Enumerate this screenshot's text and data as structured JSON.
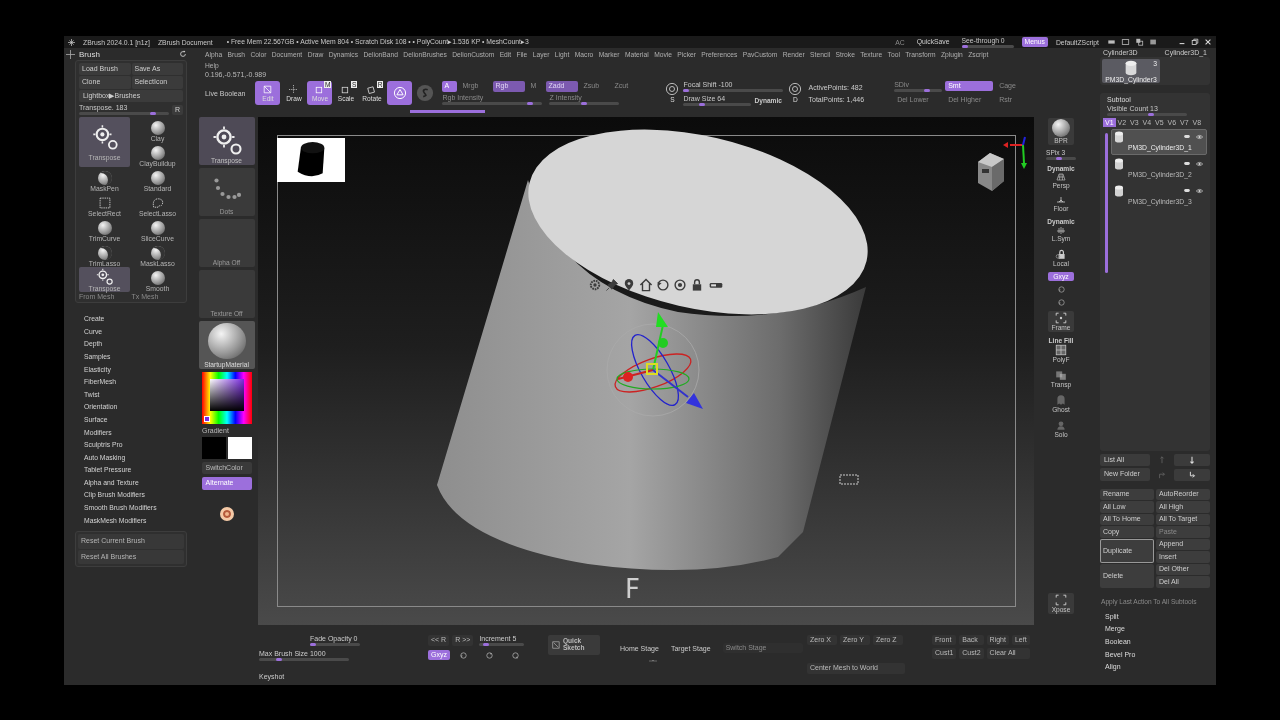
{
  "title_bar": {
    "app_name": "ZBrush 2024.0.1 [n1z]",
    "document": "ZBrush Document",
    "stats": "• Free Mem 22.567GB • Active Mem 804 • Scratch Disk 108 • • PolyCount▸1.536 KP • MeshCount▸3",
    "ac": "AC",
    "quicksave": "QuickSave",
    "see_through": {
      "label": "See-through 0",
      "level": 0
    },
    "menus": {
      "label": "Menus",
      "on": true
    },
    "script": "DefaultZScript"
  },
  "menu_bar": [
    "Alpha",
    "Brush",
    "Color",
    "Document",
    "Draw",
    "Dynamics",
    "DelionBand",
    "DelionBrushes",
    "DelionCustom",
    "Edit",
    "File",
    "Layer",
    "Light",
    "Macro",
    "Marker",
    "Material",
    "Movie",
    "Picker",
    "Preferences",
    "PavCustom",
    "Render",
    "Stencil",
    "Stroke",
    "Texture",
    "Tool",
    "Transform",
    "Zplugin",
    "Zscript",
    "Help"
  ],
  "coordinates": "0.196,-0.571,-0.989",
  "brush_palette": {
    "title": "Brush",
    "buttons": [
      "Load Brush",
      "Save As",
      "Clone",
      "SelectIcon"
    ],
    "lightbox": "Lightbox▶Brushes",
    "slider": {
      "label": "Transpose. 183",
      "level": 0.85
    },
    "r_button": "R",
    "current": {
      "label": "Transpose",
      "kind": "transpose",
      "selected": true
    },
    "brushes": [
      {
        "label": "Clay",
        "kind": "sphere",
        "selected": false
      },
      {
        "label": "ClayBuildup",
        "kind": "sphere",
        "selected": false
      },
      {
        "label": "MaskPen",
        "kind": "mask",
        "selected": false
      },
      {
        "label": "Standard",
        "kind": "sphere",
        "selected": false
      },
      {
        "label": "SelectRect",
        "kind": "rect",
        "selected": false
      },
      {
        "label": "SelectLasso",
        "kind": "lasso",
        "selected": false
      },
      {
        "label": "TrimCurve",
        "kind": "trim",
        "selected": false
      },
      {
        "label": "SliceCurve",
        "kind": "trim",
        "selected": false
      },
      {
        "label": "TrimLasso",
        "kind": "mask",
        "selected": false
      },
      {
        "label": "MaskLasso",
        "kind": "mask",
        "selected": false
      },
      {
        "label": "Transpose",
        "kind": "transpose",
        "selected": true
      },
      {
        "label": "Smooth",
        "kind": "sphere",
        "selected": false
      }
    ],
    "from_mesh": "From Mesh",
    "tx_mesh": "Tx Mesh",
    "subpalettes": [
      "Create",
      "Curve",
      "Depth",
      "Samples",
      "Elasticity",
      "FiberMesh",
      "Twist",
      "Orientation",
      "Surface",
      "Modifiers",
      "Sculptris Pro",
      "Auto Masking",
      "Tablet Pressure",
      "Alpha and Texture",
      "Clip Brush Modifiers",
      "Smooth Brush Modifiers",
      "MaskMesh Modifiers"
    ],
    "reset_buttons": [
      "Reset Current Brush",
      "Reset All Brushes"
    ]
  },
  "toolbar": {
    "live_boolean": "Live Boolean",
    "transform_modes": [
      {
        "label": "Edit",
        "kind": "edit",
        "on": true
      },
      {
        "label": "Draw",
        "kind": "draw",
        "on": false
      },
      {
        "label": "Move",
        "kind": "move",
        "letter": "M",
        "on": true
      },
      {
        "label": "Scale",
        "kind": "scale",
        "letter": "S",
        "on": false
      },
      {
        "label": "Rotate",
        "kind": "rotate",
        "letter": "R",
        "on": false
      }
    ],
    "gizmo": {
      "on": true
    },
    "channels": [
      {
        "label": "A",
        "on": true
      },
      {
        "label": "Mrgb",
        "on": false
      },
      {
        "label": "Rgb",
        "on": true
      },
      {
        "label": "M",
        "on": false
      },
      {
        "label": "Zadd",
        "on": true
      },
      {
        "label": "Zsub",
        "on": false
      },
      {
        "label": "Zcut",
        "on": false
      }
    ],
    "rgb_intensity": {
      "label": "Rgb Intensity",
      "level": 0.9
    },
    "z_intensity": {
      "label": "Z Intensity",
      "level": 0.5
    },
    "focal_icon_letter": "S",
    "focal_shift": {
      "label": "Focal Shift -100",
      "level": 0
    },
    "draw_size": {
      "label": "Draw Size 64",
      "level": 0.25
    },
    "dynamic": "Dynamic",
    "points_icon_letter": "D",
    "active_points": "ActivePoints: 482",
    "total_points": "TotalPoints: 1,446",
    "sdiv": {
      "label": "SDiv",
      "level": 0.7
    },
    "smt": {
      "label": "Smt",
      "on": true
    },
    "cage": "Cage",
    "del_lower": "Del Lower",
    "del_higher": "Del Higher",
    "rstr": "Rstr"
  },
  "tool_strip": [
    {
      "kind": "transpose",
      "label": "Transpose"
    },
    {
      "kind": "dots",
      "label": "Dots"
    },
    {
      "kind": "blank",
      "label": "Alpha Off"
    },
    {
      "kind": "blank",
      "label": "Texture Off"
    },
    {
      "kind": "material",
      "label": "StartupMaterial"
    }
  ],
  "color": {
    "gradient": "Gradient",
    "switch": "SwitchColor",
    "alternate": {
      "label": "Alternate",
      "on": true
    }
  },
  "canvas": {
    "overlay_letter": "F"
  },
  "shelf": [
    {
      "kind": "bpr",
      "label": "BPR"
    },
    {
      "kind": "slider",
      "label": "SPix 3",
      "level": 0.4
    },
    {
      "kind": "persp",
      "caption": "Dynamic",
      "label": "Persp"
    },
    {
      "kind": "floor",
      "label": "Floor"
    },
    {
      "kind": "lsym",
      "caption": "Dynamic",
      "label": "L.Sym"
    },
    {
      "kind": "local",
      "label": "Local"
    },
    {
      "kind": "toggle",
      "label": "Gxyz",
      "on": true
    },
    {
      "kind": "rotate"
    },
    {
      "kind": "rotate"
    },
    {
      "kind": "frame",
      "label": "Frame"
    },
    {
      "kind": "polyf",
      "caption": "Line Fill",
      "label": "PolyF"
    },
    {
      "kind": "transp",
      "label": "Transp"
    },
    {
      "kind": "ghost",
      "label": "Ghost"
    },
    {
      "kind": "solo",
      "label": "Solo"
    },
    {
      "kind": "xpose",
      "label": "Xpose"
    }
  ],
  "bottom_bar": {
    "fade_opacity": {
      "label": "Fade Opacity 0",
      "level": 0
    },
    "max_brush_size": {
      "label": "Max Brush Size 1000",
      "level": 0.2
    },
    "keyshot": "Keyshot",
    "prev": "<< R",
    "next": "R >>",
    "increment": {
      "label": "Increment 5",
      "level": 0.1
    },
    "gxyz": {
      "label": "Gxyz",
      "on": true
    },
    "quick_sketch": "Quick Sketch",
    "home_stage": "Home Stage",
    "target_stage": "Target Stage",
    "switch_stage": "Switch Stage",
    "zero": [
      "Zero X",
      "Zero Y",
      "Zero Z"
    ],
    "center_mesh": "Center Mesh to World",
    "views": [
      "Front",
      "Back",
      "Right",
      "Left",
      "Cust1",
      "Cust2",
      "Clear All"
    ]
  },
  "subtool_panel": {
    "tool_names": [
      "Cylinder3D",
      "Cylinder3D_1"
    ],
    "current_tool": {
      "label": "PM3D_Cylinder3",
      "count": "3"
    },
    "title": "Subtool",
    "visible_count": {
      "label": "Visible Count 13",
      "level": 0.55
    },
    "tabs": [
      {
        "label": "V1",
        "selected": true
      },
      {
        "label": "V2",
        "selected": false
      },
      {
        "label": "V3",
        "selected": false
      },
      {
        "label": "V4",
        "selected": false
      },
      {
        "label": "V5",
        "selected": false
      },
      {
        "label": "V6",
        "selected": false
      },
      {
        "label": "V7",
        "selected": false
      },
      {
        "label": "V8",
        "selected": false
      }
    ],
    "subtools": [
      {
        "name": "PM3D_Cylinder3D_1",
        "selected": true
      },
      {
        "name": "PM3D_Cylinder3D_2",
        "selected": false
      },
      {
        "name": "PM3D_Cylinder3D_3",
        "selected": false
      }
    ],
    "list_all": "List All",
    "new_folder": "New Folder",
    "actions": [
      {
        "label": "Rename",
        "tall": false,
        "disabled": false,
        "selected": false
      },
      {
        "label": "All Low",
        "tall": false,
        "disabled": false,
        "selected": false
      },
      {
        "label": "All To Home",
        "tall": false,
        "disabled": false,
        "selected": false
      },
      {
        "label": "Copy",
        "tall": false,
        "disabled": false,
        "selected": false
      },
      {
        "label": "Duplicate",
        "tall": true,
        "disabled": false,
        "selected": true
      },
      {
        "label": "Delete",
        "tall": true,
        "disabled": false,
        "selected": false
      },
      {
        "label": "AutoReorder",
        "tall": false,
        "disabled": false,
        "selected": false
      },
      {
        "label": "All High",
        "tall": false,
        "disabled": false,
        "selected": false
      },
      {
        "label": "All To Target",
        "tall": false,
        "disabled": false,
        "selected": false
      },
      {
        "label": "Paste",
        "tall": false,
        "disabled": true,
        "selected": false
      },
      {
        "label": "Append",
        "tall": false,
        "disabled": false,
        "selected": false
      },
      {
        "label": "Insert",
        "tall": false,
        "disabled": false,
        "selected": false
      },
      {
        "label": "Del Other",
        "tall": false,
        "disabled": false,
        "selected": false
      },
      {
        "label": "Del All",
        "tall": false,
        "disabled": false,
        "selected": false
      }
    ],
    "apply_all": "Apply Last Action To All Subtools",
    "operations": [
      "Split",
      "Merge",
      "Boolean",
      "Bevel Pro",
      "Align"
    ]
  }
}
